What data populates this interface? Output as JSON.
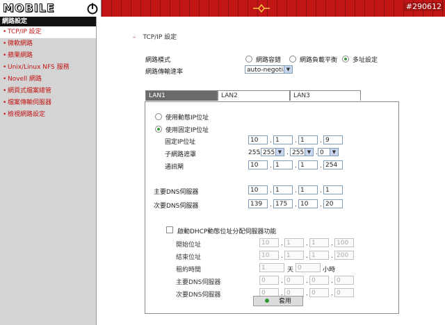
{
  "header": {
    "logo_text": "MOBILE",
    "tag": "#290612"
  },
  "sidebar": {
    "title": "網路設定",
    "items": [
      {
        "label": "TCP/IP 設定",
        "active": true
      },
      {
        "label": "微軟網路",
        "active": false
      },
      {
        "label": "蘋果網路",
        "active": false
      },
      {
        "label": "Unix/Linux NFS 服務",
        "active": false
      },
      {
        "label": "Novell 網路",
        "active": false
      },
      {
        "label": "網頁式檔案總管",
        "active": false
      },
      {
        "label": "檔案傳輸伺服器",
        "active": false
      },
      {
        "label": "檢視網路設定",
        "active": false
      }
    ]
  },
  "main": {
    "section_title": "TCP/IP 設定",
    "network_mode_label": "網路模式",
    "modes": [
      {
        "label": "網路容錯",
        "selected": false
      },
      {
        "label": "網路負載平衡",
        "selected": false
      },
      {
        "label": "多址設定",
        "selected": true
      }
    ],
    "speed_label": "網路傳輸速率",
    "speed_value": "auto-negotiat",
    "tabs": [
      "LAN1",
      "LAN2",
      "LAN3"
    ],
    "lan": {
      "dynamic_label": "使用動態IP位址",
      "static_label": "使用固定IP位址",
      "ip_label": "固定IP位址",
      "ip": [
        "10",
        "1",
        "1",
        "9"
      ],
      "mask_label": "子網路遮罩",
      "mask_first": "255",
      "mask": [
        "255",
        "255",
        "0"
      ],
      "gateway_label": "通訊閘",
      "gateway": [
        "10",
        "1",
        "1",
        "254"
      ],
      "dns1_label": "主要DNS伺服器",
      "dns1": [
        "10",
        "1",
        "1",
        "1"
      ],
      "dns2_label": "次要DNS伺服器",
      "dns2": [
        "139",
        "175",
        "10",
        "20"
      ],
      "dhcp_label": "啟動DHCP動態位址分配伺服器功能",
      "start_label": "開始位址",
      "start": [
        "10",
        "1",
        "1",
        "100"
      ],
      "end_label": "結束位址",
      "end": [
        "10",
        "1",
        "1",
        "200"
      ],
      "lease_label": "租約時間",
      "lease_days": "1",
      "days_unit": "天",
      "lease_hours": "0",
      "hours_unit": "小時",
      "dhcp_dns1_label": "主要DNS伺服器",
      "dhcp_dns1": [
        "0",
        "0",
        "0",
        "0"
      ],
      "dhcp_dns2_label": "次要DNS伺服器",
      "dhcp_dns2": [
        "0",
        "0",
        "0",
        "0"
      ]
    },
    "apply_label": "套用"
  },
  "colors": {
    "brand_red": "#c21616",
    "sidebar_bg": "#d4d4d4",
    "accent_green": "#2e9a2e"
  }
}
